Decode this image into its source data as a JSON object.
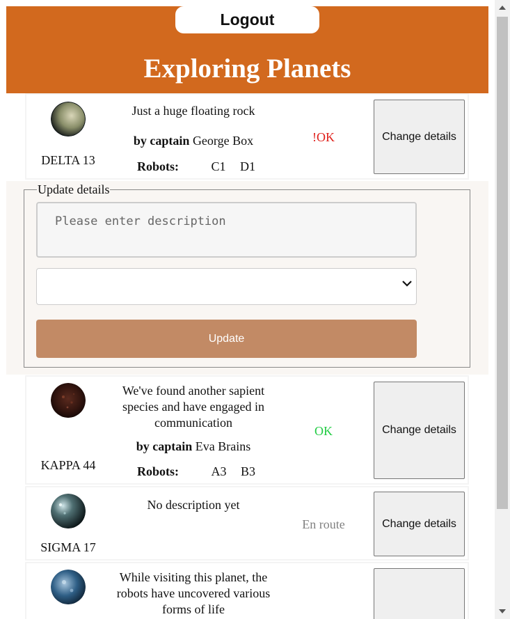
{
  "header": {
    "logout_label": "Logout",
    "title": "Exploring Planets",
    "bg_color": "#d2691e"
  },
  "planets": [
    {
      "name": "DELTA 13",
      "description": "Just a huge floating rock",
      "captain_prefix": "by captain",
      "captain": "George Box",
      "robots_label": "Robots:",
      "robots": [
        "C1",
        "D1"
      ],
      "status": "!OK",
      "status_color": "#e0201b",
      "button_label": "Change details"
    },
    {
      "name": "KAPPA 44",
      "description": "We've found another sapient species and have engaged in communication",
      "captain_prefix": "by captain",
      "captain": "Eva Brains",
      "robots_label": "Robots:",
      "robots": [
        "A3",
        "B3"
      ],
      "status": "OK",
      "status_color": "#22cc44",
      "button_label": "Change details"
    },
    {
      "name": "SIGMA 17",
      "description": "No description yet",
      "status": "En route",
      "status_color": "#808080",
      "button_label": "Change details"
    },
    {
      "description": "While visiting this planet, the robots have uncovered various forms of life"
    }
  ],
  "update_form": {
    "legend": "Update details",
    "description_placeholder": "Please enter description",
    "select_value": "",
    "update_label": "Update",
    "update_color": "#c28a65"
  }
}
